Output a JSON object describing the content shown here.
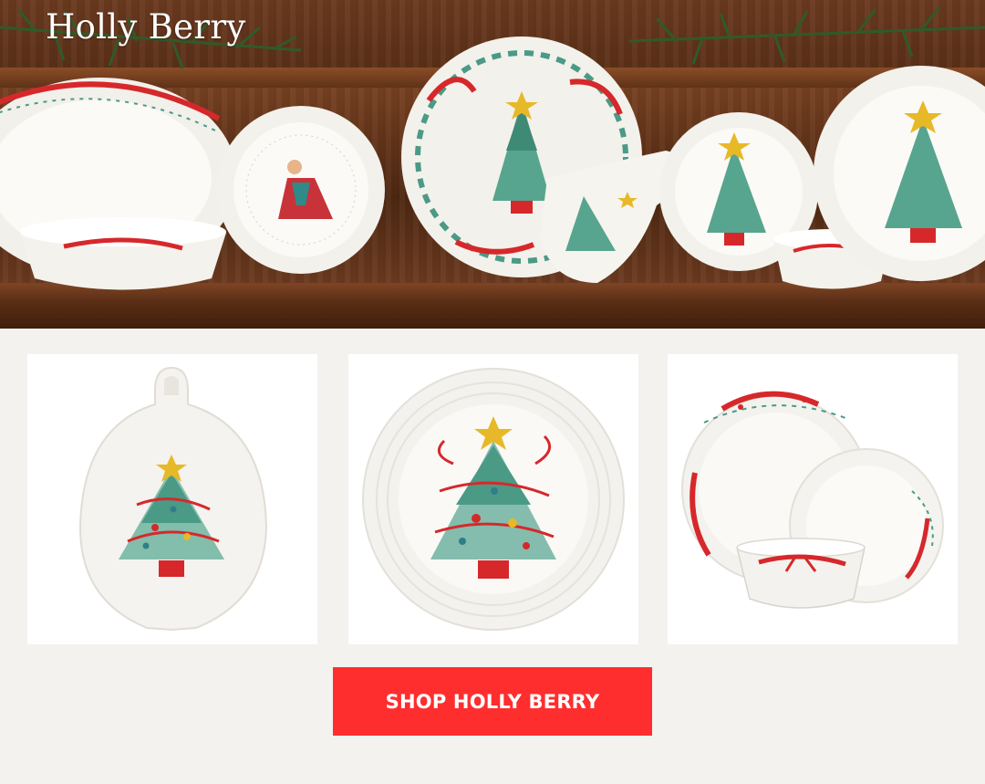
{
  "hero": {
    "title": "Holly Berry"
  },
  "cards": [
    {
      "name": "ornament-tray",
      "icon": "tree-ornament-tray-icon"
    },
    {
      "name": "tree-salad-plate",
      "icon": "tree-plate-icon"
    },
    {
      "name": "place-setting",
      "icon": "place-setting-icon"
    }
  ],
  "cta": {
    "label": "SHOP HOLLY BERRY",
    "color": "#ff2e2e"
  },
  "colors": {
    "background": "#f3f2ef",
    "ribbon_red": "#d6282b",
    "leaf_green": "#4a9a86",
    "star_gold": "#e7b928",
    "wood": "#5a2f17"
  }
}
